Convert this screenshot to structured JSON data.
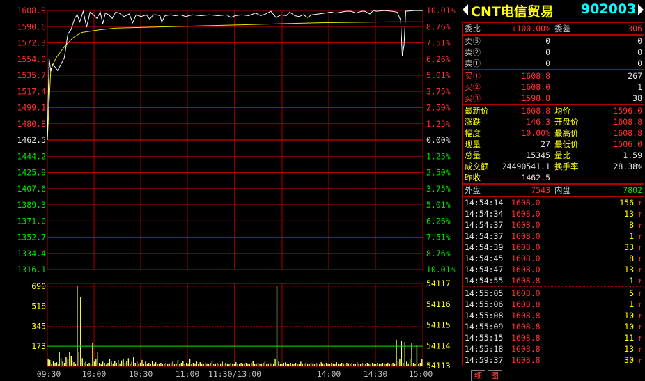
{
  "stock": {
    "name": "CNT电信贸易",
    "code": "902003"
  },
  "chart": {
    "price_ticks": [
      {
        "label": "1608.9",
        "cls": "red"
      },
      {
        "label": "1590.6",
        "cls": "red"
      },
      {
        "label": "1572.3",
        "cls": "red"
      },
      {
        "label": "1554.0",
        "cls": "red"
      },
      {
        "label": "1535.7",
        "cls": "red"
      },
      {
        "label": "1517.4",
        "cls": "red"
      },
      {
        "label": "1499.1",
        "cls": "red"
      },
      {
        "label": "1480.8",
        "cls": "red"
      },
      {
        "label": "1462.5",
        "cls": "white"
      },
      {
        "label": "1444.2",
        "cls": "green"
      },
      {
        "label": "1425.9",
        "cls": "green"
      },
      {
        "label": "1407.6",
        "cls": "green"
      },
      {
        "label": "1389.3",
        "cls": "green"
      },
      {
        "label": "1371.0",
        "cls": "green"
      },
      {
        "label": "1352.7",
        "cls": "green"
      },
      {
        "label": "1334.4",
        "cls": "green"
      },
      {
        "label": "1316.1",
        "cls": "green"
      }
    ],
    "pct_ticks": [
      {
        "label": "10.01%",
        "cls": "red"
      },
      {
        "label": "8.76%",
        "cls": "red"
      },
      {
        "label": "7.51%",
        "cls": "red"
      },
      {
        "label": "6.26%",
        "cls": "red"
      },
      {
        "label": "5.01%",
        "cls": "red"
      },
      {
        "label": "3.75%",
        "cls": "red"
      },
      {
        "label": "2.50%",
        "cls": "red"
      },
      {
        "label": "1.25%",
        "cls": "red"
      },
      {
        "label": "0.00%",
        "cls": "white"
      },
      {
        "label": "1.25%",
        "cls": "green"
      },
      {
        "label": "2.50%",
        "cls": "green"
      },
      {
        "label": "3.75%",
        "cls": "green"
      },
      {
        "label": "5.01%",
        "cls": "green"
      },
      {
        "label": "6.26%",
        "cls": "green"
      },
      {
        "label": "7.51%",
        "cls": "green"
      },
      {
        "label": "8.76%",
        "cls": "green"
      },
      {
        "label": "10.01%",
        "cls": "green"
      }
    ],
    "vol_ticks_left": [
      "690",
      "518",
      "345",
      "173"
    ],
    "vol_ticks_right": [
      "54117",
      "54116",
      "54115",
      "54114",
      "54113"
    ],
    "time_labels": [
      "09:30",
      "10:00",
      "10:30",
      "11:00",
      "11:30/13:00",
      "14:00",
      "14:30",
      "15:00"
    ],
    "colors": {
      "grid": "#b00000",
      "price_line": "#ffffff",
      "avg_line": "#e8e800",
      "volume": "#ffff66",
      "vol_avg": "#00e600"
    },
    "price_line": [
      [
        0,
        1462.5
      ],
      [
        2,
        1555
      ],
      [
        4,
        1540
      ],
      [
        6,
        1548
      ],
      [
        9,
        1545
      ],
      [
        12,
        1541
      ],
      [
        16,
        1548
      ],
      [
        20,
        1556
      ],
      [
        24,
        1582
      ],
      [
        28,
        1588
      ],
      [
        32,
        1600
      ],
      [
        35,
        1604
      ],
      [
        38,
        1596
      ],
      [
        42,
        1608
      ],
      [
        46,
        1590
      ],
      [
        50,
        1607
      ],
      [
        54,
        1604
      ],
      [
        58,
        1600
      ],
      [
        62,
        1607
      ],
      [
        65,
        1594
      ],
      [
        68,
        1606
      ],
      [
        72,
        1604
      ],
      [
        76,
        1600
      ],
      [
        80,
        1607
      ],
      [
        84,
        1606
      ],
      [
        90,
        1602
      ],
      [
        96,
        1605
      ],
      [
        100,
        1595
      ],
      [
        104,
        1604
      ],
      [
        110,
        1602
      ],
      [
        116,
        1604
      ],
      [
        120,
        1599
      ],
      [
        124,
        1604
      ],
      [
        128,
        1604
      ],
      [
        132,
        1603
      ],
      [
        134,
        1596
      ],
      [
        138,
        1603
      ],
      [
        144,
        1604
      ],
      [
        150,
        1603
      ],
      [
        156,
        1604
      ],
      [
        162,
        1602
      ],
      [
        170,
        1604
      ],
      [
        180,
        1603
      ],
      [
        190,
        1604
      ],
      [
        200,
        1603
      ],
      [
        210,
        1604
      ],
      [
        215,
        1601
      ],
      [
        220,
        1603
      ],
      [
        228,
        1604
      ],
      [
        236,
        1603
      ],
      [
        244,
        1606
      ],
      [
        250,
        1603
      ],
      [
        256,
        1605
      ],
      [
        262,
        1608
      ],
      [
        268,
        1601
      ],
      [
        274,
        1604
      ],
      [
        280,
        1603
      ],
      [
        284,
        1607
      ],
      [
        290,
        1603
      ],
      [
        295,
        1602
      ],
      [
        300,
        1604
      ],
      [
        305,
        1601
      ],
      [
        310,
        1604
      ],
      [
        318,
        1605
      ],
      [
        326,
        1606
      ],
      [
        332,
        1607
      ],
      [
        338,
        1606
      ],
      [
        344,
        1607
      ],
      [
        350,
        1608
      ],
      [
        356,
        1608
      ],
      [
        362,
        1606
      ],
      [
        368,
        1608
      ],
      [
        372,
        1608
      ],
      [
        378,
        1605
      ],
      [
        382,
        1608.8
      ],
      [
        386,
        1608
      ],
      [
        395,
        1608.8
      ],
      [
        404,
        1608
      ],
      [
        410,
        1607
      ],
      [
        414,
        1598
      ],
      [
        416,
        1557
      ],
      [
        418,
        1570
      ],
      [
        420,
        1608
      ],
      [
        430,
        1608.8
      ],
      [
        440,
        1608.8
      ]
    ],
    "avg_line": [
      [
        0,
        1462.5
      ],
      [
        4,
        1542
      ],
      [
        10,
        1555
      ],
      [
        20,
        1568
      ],
      [
        30,
        1578
      ],
      [
        40,
        1584
      ],
      [
        60,
        1587
      ],
      [
        80,
        1589
      ],
      [
        120,
        1590
      ],
      [
        160,
        1591
      ],
      [
        200,
        1592
      ],
      [
        240,
        1593
      ],
      [
        280,
        1594
      ],
      [
        320,
        1595
      ],
      [
        360,
        1595.5
      ],
      [
        400,
        1596
      ],
      [
        440,
        1596
      ]
    ],
    "vol_avg_level": 173,
    "volumes": [
      [
        1,
        60
      ],
      [
        3,
        55
      ],
      [
        5,
        25
      ],
      [
        7,
        45
      ],
      [
        9,
        30
      ],
      [
        11,
        35
      ],
      [
        13,
        20
      ],
      [
        14,
        120
      ],
      [
        16,
        70
      ],
      [
        18,
        45
      ],
      [
        20,
        30
      ],
      [
        22,
        80
      ],
      [
        24,
        60
      ],
      [
        26,
        120
      ],
      [
        28,
        90
      ],
      [
        29,
        50
      ],
      [
        31,
        35
      ],
      [
        33,
        20
      ],
      [
        35,
        690
      ],
      [
        37,
        120
      ],
      [
        39,
        600
      ],
      [
        41,
        70
      ],
      [
        43,
        30
      ],
      [
        45,
        40
      ],
      [
        47,
        20
      ],
      [
        49,
        30
      ],
      [
        51,
        25
      ],
      [
        53,
        200
      ],
      [
        55,
        40
      ],
      [
        57,
        60
      ],
      [
        59,
        120
      ],
      [
        61,
        30
      ],
      [
        63,
        20
      ],
      [
        65,
        40
      ],
      [
        67,
        30
      ],
      [
        69,
        15
      ],
      [
        71,
        30
      ],
      [
        73,
        60
      ],
      [
        75,
        40
      ],
      [
        77,
        25
      ],
      [
        79,
        45
      ],
      [
        81,
        30
      ],
      [
        83,
        55
      ],
      [
        85,
        25
      ],
      [
        87,
        50
      ],
      [
        89,
        60
      ],
      [
        91,
        30
      ],
      [
        93,
        45
      ],
      [
        95,
        70
      ],
      [
        97,
        25
      ],
      [
        99,
        40
      ],
      [
        101,
        80
      ],
      [
        103,
        30
      ],
      [
        105,
        40
      ],
      [
        107,
        20
      ],
      [
        109,
        30
      ],
      [
        111,
        55
      ],
      [
        113,
        25
      ],
      [
        115,
        40
      ],
      [
        117,
        20
      ],
      [
        119,
        30
      ],
      [
        121,
        20
      ],
      [
        123,
        45
      ],
      [
        125,
        25
      ],
      [
        127,
        35
      ],
      [
        129,
        20
      ],
      [
        131,
        25
      ],
      [
        133,
        30
      ],
      [
        135,
        20
      ],
      [
        137,
        25
      ],
      [
        139,
        30
      ],
      [
        141,
        20
      ],
      [
        143,
        25
      ],
      [
        145,
        30
      ],
      [
        147,
        40
      ],
      [
        149,
        20
      ],
      [
        151,
        25
      ],
      [
        153,
        55
      ],
      [
        155,
        20
      ],
      [
        157,
        30
      ],
      [
        159,
        45
      ],
      [
        161,
        20
      ],
      [
        163,
        30
      ],
      [
        165,
        25
      ],
      [
        167,
        60
      ],
      [
        169,
        20
      ],
      [
        171,
        30
      ],
      [
        173,
        25
      ],
      [
        175,
        40
      ],
      [
        177,
        20
      ],
      [
        179,
        35
      ],
      [
        181,
        25
      ],
      [
        183,
        20
      ],
      [
        185,
        30
      ],
      [
        187,
        25
      ],
      [
        189,
        20
      ],
      [
        191,
        30
      ],
      [
        193,
        45
      ],
      [
        195,
        20
      ],
      [
        197,
        25
      ],
      [
        199,
        30
      ],
      [
        201,
        20
      ],
      [
        203,
        25
      ],
      [
        205,
        40
      ],
      [
        207,
        20
      ],
      [
        209,
        30
      ],
      [
        211,
        25
      ],
      [
        213,
        20
      ],
      [
        215,
        30
      ],
      [
        217,
        25
      ],
      [
        219,
        20
      ],
      [
        221,
        35
      ],
      [
        223,
        25
      ],
      [
        225,
        20
      ],
      [
        227,
        30
      ],
      [
        229,
        25
      ],
      [
        231,
        20
      ],
      [
        233,
        30
      ],
      [
        235,
        25
      ],
      [
        237,
        20
      ],
      [
        239,
        30
      ],
      [
        241,
        45
      ],
      [
        243,
        20
      ],
      [
        245,
        25
      ],
      [
        247,
        30
      ],
      [
        249,
        20
      ],
      [
        251,
        25
      ],
      [
        253,
        30
      ],
      [
        255,
        40
      ],
      [
        257,
        20
      ],
      [
        259,
        25
      ],
      [
        261,
        30
      ],
      [
        263,
        20
      ],
      [
        265,
        25
      ],
      [
        267,
        60
      ],
      [
        269,
        690
      ],
      [
        271,
        40
      ],
      [
        273,
        25
      ],
      [
        275,
        20
      ],
      [
        277,
        30
      ],
      [
        279,
        35
      ],
      [
        281,
        25
      ],
      [
        283,
        20
      ],
      [
        285,
        30
      ],
      [
        287,
        25
      ],
      [
        289,
        20
      ],
      [
        291,
        30
      ],
      [
        293,
        25
      ],
      [
        295,
        20
      ],
      [
        297,
        40
      ],
      [
        299,
        25
      ],
      [
        301,
        20
      ],
      [
        303,
        30
      ],
      [
        305,
        25
      ],
      [
        307,
        20
      ],
      [
        309,
        30
      ],
      [
        311,
        25
      ],
      [
        313,
        20
      ],
      [
        315,
        30
      ],
      [
        317,
        25
      ],
      [
        319,
        20
      ],
      [
        321,
        35
      ],
      [
        323,
        25
      ],
      [
        325,
        20
      ],
      [
        327,
        30
      ],
      [
        329,
        25
      ],
      [
        331,
        20
      ],
      [
        333,
        30
      ],
      [
        335,
        25
      ],
      [
        337,
        20
      ],
      [
        339,
        35
      ],
      [
        341,
        25
      ],
      [
        343,
        20
      ],
      [
        345,
        30
      ],
      [
        347,
        25
      ],
      [
        349,
        20
      ],
      [
        351,
        30
      ],
      [
        353,
        25
      ],
      [
        355,
        20
      ],
      [
        357,
        30
      ],
      [
        359,
        25
      ],
      [
        361,
        20
      ],
      [
        363,
        35
      ],
      [
        365,
        25
      ],
      [
        367,
        20
      ],
      [
        369,
        30
      ],
      [
        371,
        25
      ],
      [
        373,
        20
      ],
      [
        375,
        30
      ],
      [
        377,
        25
      ],
      [
        379,
        20
      ],
      [
        381,
        30
      ],
      [
        383,
        25
      ],
      [
        385,
        20
      ],
      [
        387,
        30
      ],
      [
        389,
        25
      ],
      [
        391,
        20
      ],
      [
        393,
        30
      ],
      [
        395,
        25
      ],
      [
        397,
        20
      ],
      [
        399,
        30
      ],
      [
        401,
        25
      ],
      [
        403,
        20
      ],
      [
        405,
        30
      ],
      [
        407,
        25
      ],
      [
        409,
        230
      ],
      [
        411,
        40
      ],
      [
        413,
        60
      ],
      [
        415,
        220
      ],
      [
        417,
        30
      ],
      [
        419,
        210
      ],
      [
        421,
        40
      ],
      [
        423,
        25
      ],
      [
        425,
        60
      ],
      [
        427,
        200
      ],
      [
        429,
        30
      ],
      [
        431,
        25
      ],
      [
        433,
        180
      ],
      [
        435,
        20
      ],
      [
        437,
        30
      ],
      [
        439,
        60
      ]
    ]
  },
  "quote": {
    "weibi": {
      "label": "委比",
      "value": "+100.00%",
      "label2": "委差",
      "value2": "306"
    },
    "asks": [
      {
        "label": "卖⑤",
        "price": "0",
        "vol": "0"
      },
      {
        "label": "卖②",
        "price": "0",
        "vol": "0"
      },
      {
        "label": "卖①",
        "price": "0",
        "vol": "0"
      }
    ],
    "bids": [
      {
        "label": "买①",
        "price": "1608.8",
        "vol": "267"
      },
      {
        "label": "买②",
        "price": "1608.0",
        "vol": "1"
      },
      {
        "label": "买③",
        "price": "1598.8",
        "vol": "38"
      }
    ],
    "stats": [
      {
        "l1": "最新价",
        "v1": "1608.8",
        "c1": "red",
        "l2": "均价",
        "v2": "1596.0",
        "c2": "red"
      },
      {
        "l1": "涨跌",
        "v1": "146.3",
        "c1": "red",
        "l2": "开盘价",
        "v2": "1608.8",
        "c2": "red"
      },
      {
        "l1": "幅度",
        "v1": "10.00%",
        "c1": "red",
        "l2": "最高价",
        "v2": "1608.8",
        "c2": "red"
      },
      {
        "l1": "现量",
        "v1": "27",
        "c1": "white",
        "l2": "最低价",
        "v2": "1506.0",
        "c2": "red"
      },
      {
        "l1": "总量",
        "v1": "15345",
        "c1": "white",
        "l2": "量比",
        "v2": "1.59",
        "c2": "white"
      },
      {
        "l1": "成交额",
        "v1": "24490541.1",
        "c1": "white",
        "l2": "换手率",
        "v2": "28.38%",
        "c2": "white"
      },
      {
        "l1": "昨收",
        "v1": "1462.5",
        "c1": "white",
        "l2": "",
        "v2": "",
        "c2": "white"
      }
    ],
    "outer": {
      "label": "外盘",
      "value": "7543",
      "label2": "内盘",
      "value2": "7802"
    }
  },
  "ticks": [
    {
      "time": "14:54:14",
      "price": "1608.0",
      "vol": "156",
      "arrow": "↑"
    },
    {
      "time": "14:54:34",
      "price": "1608.0",
      "vol": "13",
      "arrow": "↑"
    },
    {
      "time": "14:54:37",
      "price": "1608.0",
      "vol": "8",
      "arrow": "↑"
    },
    {
      "time": "14:54:37",
      "price": "1608.0",
      "vol": "1",
      "arrow": "↑"
    },
    {
      "time": "14:54:39",
      "price": "1608.0",
      "vol": "33",
      "arrow": "↑"
    },
    {
      "time": "14:54:45",
      "price": "1608.0",
      "vol": "8",
      "arrow": "↑"
    },
    {
      "time": "14:54:47",
      "price": "1608.0",
      "vol": "13",
      "arrow": "↑"
    },
    {
      "time": "14:54:55",
      "price": "1608.8",
      "vol": "1",
      "arrow": "↑"
    },
    {
      "time": "14:55:05",
      "price": "1608.0",
      "vol": "5",
      "arrow": "↑"
    },
    {
      "time": "14:55:06",
      "price": "1608.8",
      "vol": "1",
      "arrow": "↑"
    },
    {
      "time": "14:55:08",
      "price": "1608.8",
      "vol": "10",
      "arrow": "↑"
    },
    {
      "time": "14:55:09",
      "price": "1608.8",
      "vol": "10",
      "arrow": "↑"
    },
    {
      "time": "14:55:15",
      "price": "1608.8",
      "vol": "11",
      "arrow": "↑"
    },
    {
      "time": "14:55:18",
      "price": "1608.8",
      "vol": "13",
      "arrow": "↑"
    },
    {
      "time": "14:59:37",
      "price": "1608.8",
      "vol": "30",
      "arrow": "↑"
    }
  ],
  "tabs": [
    "细",
    "图"
  ]
}
